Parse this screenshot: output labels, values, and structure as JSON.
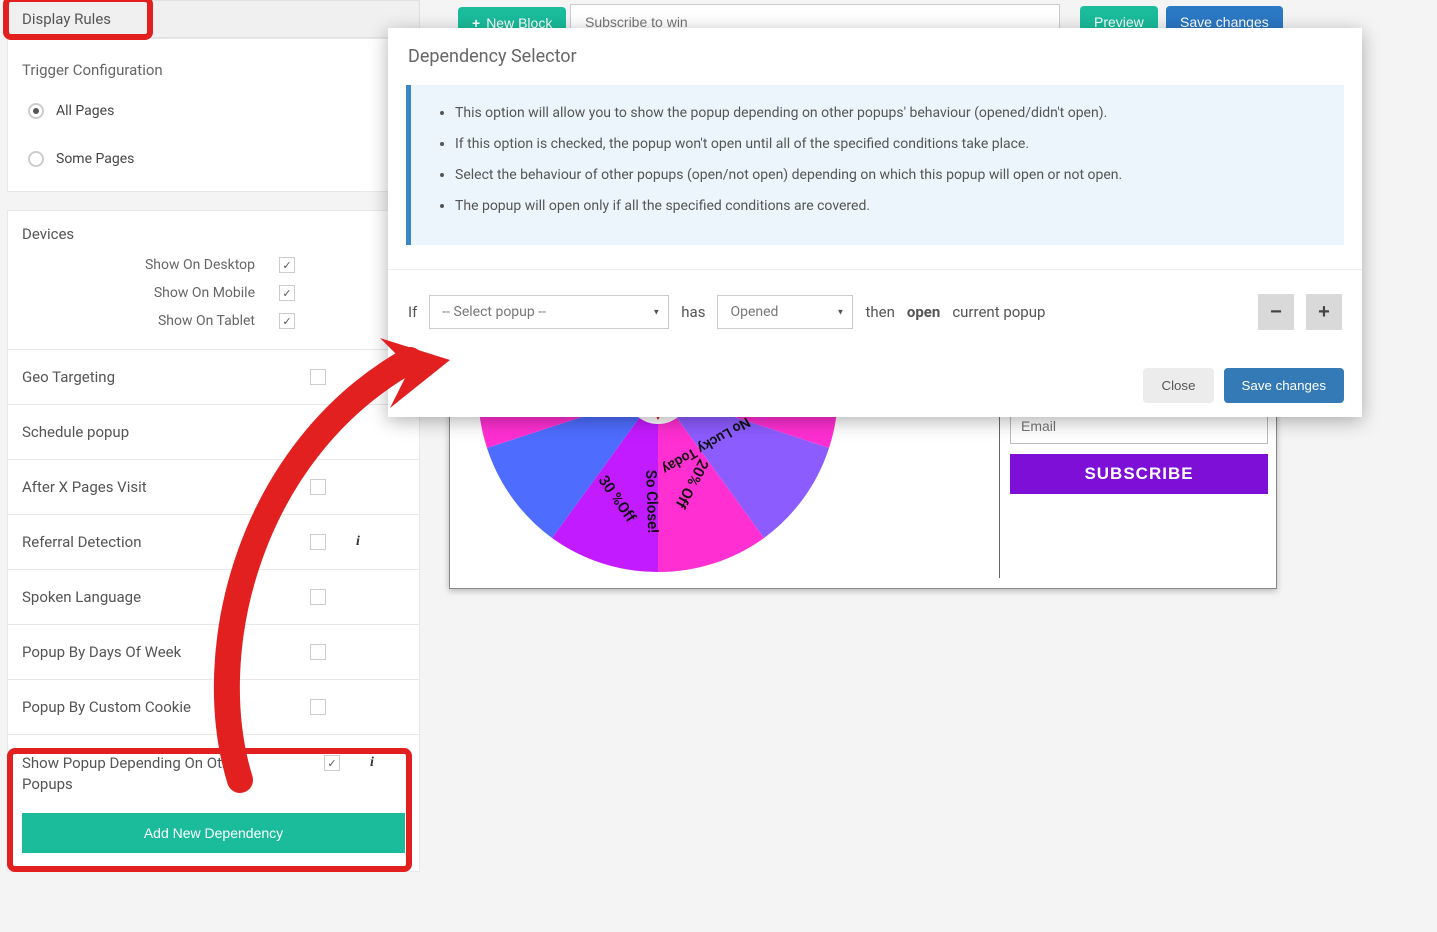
{
  "sidebar": {
    "display_rules": "Display Rules",
    "trigger_config": "Trigger Configuration",
    "all_pages": "All Pages",
    "some_pages": "Some Pages",
    "devices_title": "Devices",
    "show_desktop": "Show On Desktop",
    "show_mobile": "Show On Mobile",
    "show_tablet": "Show On Tablet",
    "geo": "Geo Targeting",
    "schedule": "Schedule popup",
    "after_x": "After X Pages Visit",
    "referral": "Referral Detection",
    "spoken": "Spoken Language",
    "days": "Popup By Days Of Week",
    "cookie": "Popup By Custom Cookie",
    "depending": "Show Popup Depending On Other Popups",
    "add_dep": "Add New Dependency"
  },
  "top": {
    "new_block": "New Block",
    "input_value": "Subscribe to win",
    "preview": "Preview",
    "save": "Save changes"
  },
  "modal": {
    "title": "Dependency Selector",
    "bullet1": "This option will allow you to show the popup depending on other popups' behaviour (opened/didn't open).",
    "bullet2": "If this option is checked, the popup won't open until all of the specified conditions take place.",
    "bullet3": "Select the behaviour of other popups (open/not open) depending on which this popup will open or not open.",
    "bullet4": "The popup will open only if all the specified conditions are covered.",
    "if": "If",
    "select_popup": "-- Select popup --",
    "has": "has",
    "opened": "Opened",
    "then": "then",
    "open_word": "open",
    "current_popup": "current popup",
    "close": "Close",
    "save": "Save changes"
  },
  "wheel": {
    "slice_30": "30 %Off",
    "slice_soclose": "So Close!",
    "slice_20": "20% Off",
    "slice_nolucky": "No Lucky Today"
  },
  "form": {
    "email_placeholder": "Email",
    "subscribe": "SUBSCRIBE"
  }
}
